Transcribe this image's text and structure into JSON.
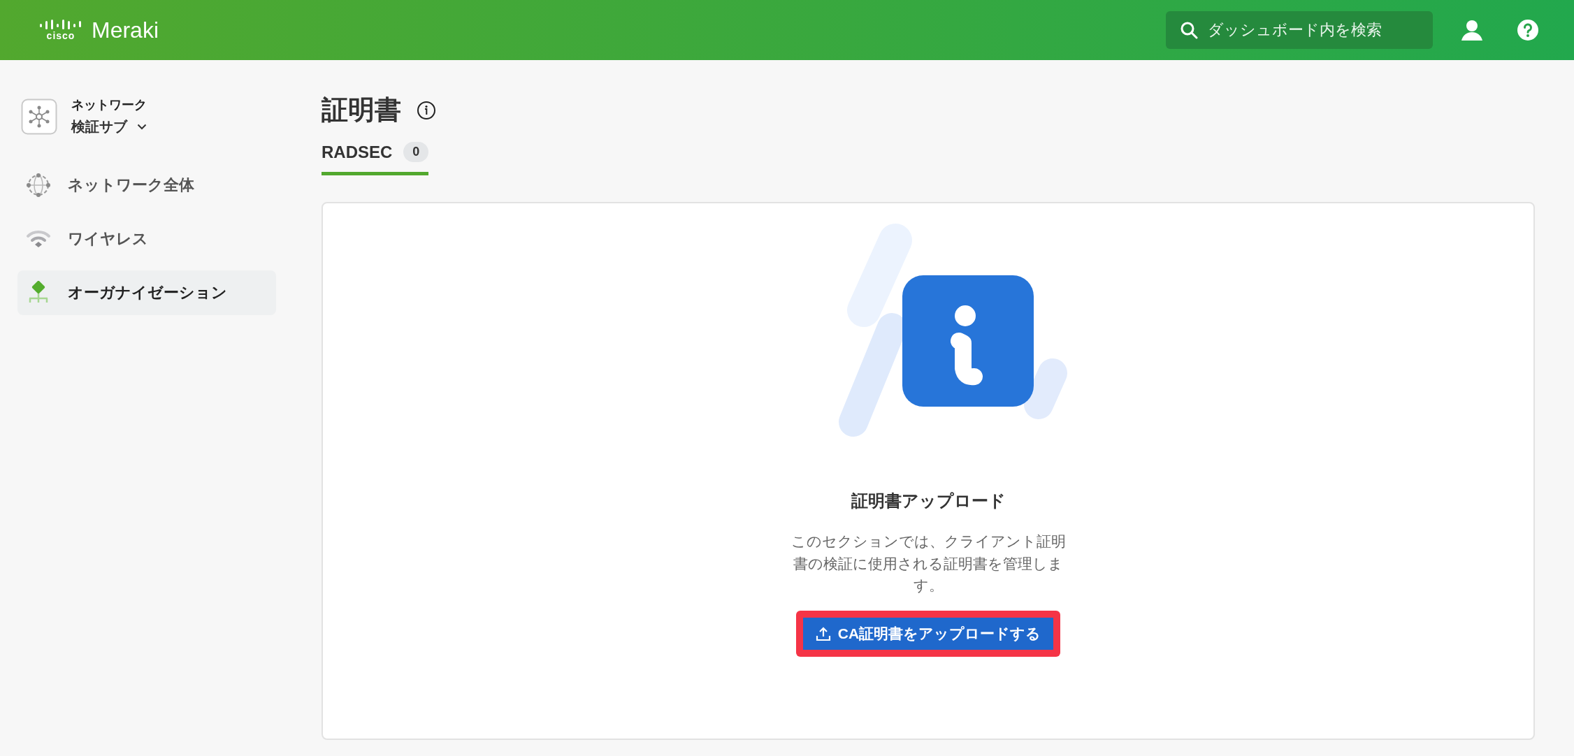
{
  "header": {
    "logo_small": "cisco",
    "logo_product": "Meraki",
    "search": {
      "placeholder": "ダッシュボード内を検索"
    }
  },
  "sidebar": {
    "network_selector": {
      "label": "ネットワーク",
      "value": "検証サブ"
    },
    "items": [
      {
        "kind": "globe",
        "label": "ネットワーク全体",
        "selected": false
      },
      {
        "kind": "wireless",
        "label": "ワイヤレス",
        "selected": false
      },
      {
        "kind": "organization",
        "label": "オーガナイゼーション",
        "selected": true
      }
    ]
  },
  "page": {
    "title": "証明書",
    "tabs": [
      {
        "label": "RADSEC",
        "count": "0",
        "selected": true
      }
    ],
    "empty_state": {
      "title": "証明書アップロード",
      "description": "このセクションでは、クライアント証明書の検証に使用される証明書を管理します。",
      "button": {
        "label": "CA証明書をアップロードする",
        "highlighted": true
      }
    }
  }
}
